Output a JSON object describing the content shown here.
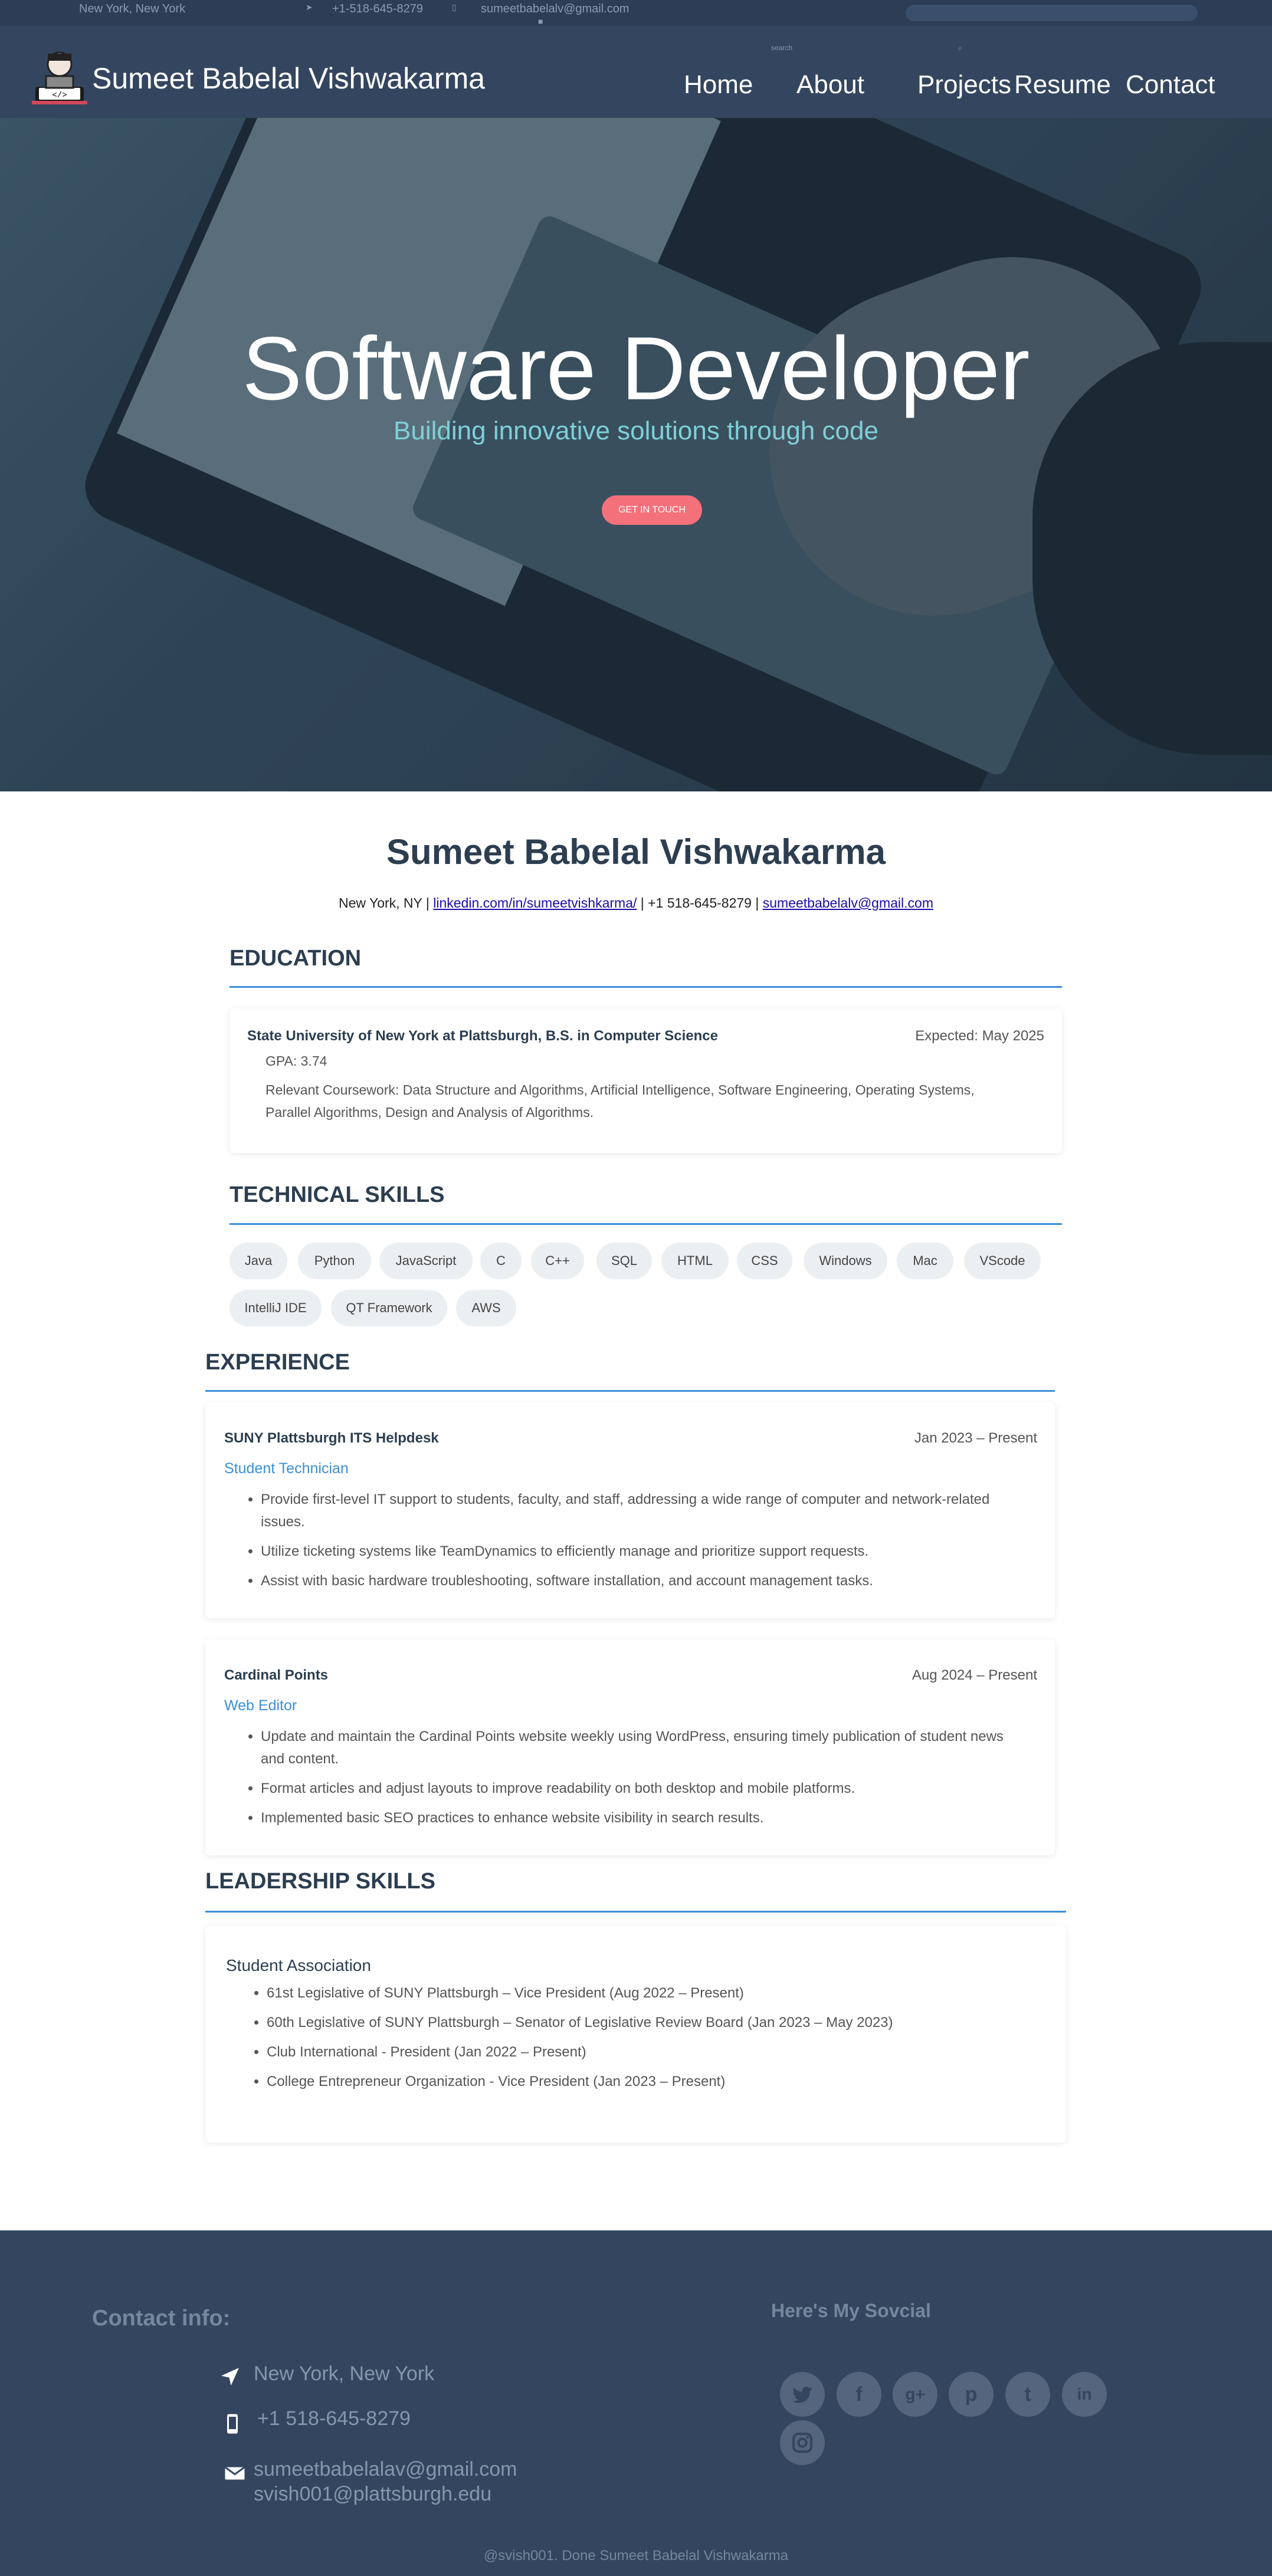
{
  "topbar": {
    "location": "New York, New York",
    "phone": "+1-518-645-8279",
    "email": "sumeetbabelalv@gmail.com",
    "search_label": "search"
  },
  "nav": {
    "brand": "Sumeet Babelal Vishwakarma",
    "links": [
      "Home",
      "About",
      "Projects",
      "Resume",
      "Contact"
    ]
  },
  "hero": {
    "title": "Software Developer",
    "subtitle": "Building innovative solutions through code",
    "cta": "GET IN TOUCH"
  },
  "resume": {
    "name": "Sumeet Babelal Vishwakarma",
    "contact_prefix": "New York, NY |",
    "linkedin": "linkedin.com/in/sumeetvishkarma/",
    "contact_mid": "| +1 518-645-8279 |",
    "email": "sumeetbabelalv@gmail.com",
    "education": {
      "title": "EDUCATION",
      "school": "State University of New York at Plattsburgh, B.S. in Computer Science",
      "date": "Expected: May 2025",
      "gpa": "GPA: 3.74",
      "coursework_1": "Relevant Coursework: Data Structure and Algorithms, Artificial Intelligence, Software Engineering, Operating Systems,",
      "coursework_2": "Parallel Algorithms, Design and Analysis of Algorithms."
    },
    "skills": {
      "title": "TECHNICAL SKILLS",
      "items": [
        "Java",
        "Python",
        "JavaScript",
        "C",
        "C++",
        "SQL",
        "HTML",
        "CSS",
        "Windows",
        "Mac",
        "VScode",
        "IntelliJ IDE",
        "QT Framework",
        "AWS"
      ]
    },
    "experience": {
      "title": "EXPERIENCE",
      "jobs": [
        {
          "org": "SUNY Plattsburgh ITS Helpdesk",
          "date": "Jan 2023 – Present",
          "role": "Student Technician",
          "bullets": [
            "Provide first-level IT support to students, faculty, and staff, addressing a wide range of computer and network-related issues.",
            "Utilize ticketing systems like TeamDynamics to efficiently manage and prioritize support requests.",
            "Assist with basic hardware troubleshooting, software installation, and account management tasks."
          ]
        },
        {
          "org": "Cardinal Points",
          "date": "Aug 2024 – Present",
          "role": "Web Editor",
          "bullets": [
            "Update and maintain the Cardinal Points website weekly using WordPress, ensuring timely publication of student news and content.",
            "Format articles and adjust layouts to improve readability on both desktop and mobile platforms.",
            "Implemented basic SEO practices to enhance website visibility in search results."
          ]
        }
      ]
    },
    "leadership": {
      "title": "LEADERSHIP SKILLS",
      "org": "Student Association",
      "items": [
        "61st Legislative of SUNY Plattsburgh – Vice President (Aug 2022 – Present)",
        "60th Legislative of SUNY Plattsburgh – Senator of Legislative Review Board (Jan 2023 – May 2023)",
        "Club International - President (Jan 2022 – Present)",
        "College Entrepreneur Organization - Vice President (Jan 2023 – Present)"
      ]
    }
  },
  "footer": {
    "contact_title": "Contact info:",
    "social_title": "Here's My Sovcial",
    "location": "New York, New York",
    "phone": "+1 518-645-8279",
    "email_1": "sumeetbabelalav@gmail.com",
    "email_2": "svish001@plattsburgh.edu",
    "social_icons": [
      "twitter-icon",
      "facebook-icon",
      "google-plus-icon",
      "pinterest-icon",
      "tumblr-icon",
      "linkedin-icon",
      "instagram-icon"
    ],
    "copyright": "@svish001. Done Sumeet Babelal Vishwakarma"
  },
  "colors": {
    "navy": "#34465f",
    "accent": "#3b8fd9",
    "cta": "#f4707a",
    "subtitle": "#7ed0d8"
  }
}
